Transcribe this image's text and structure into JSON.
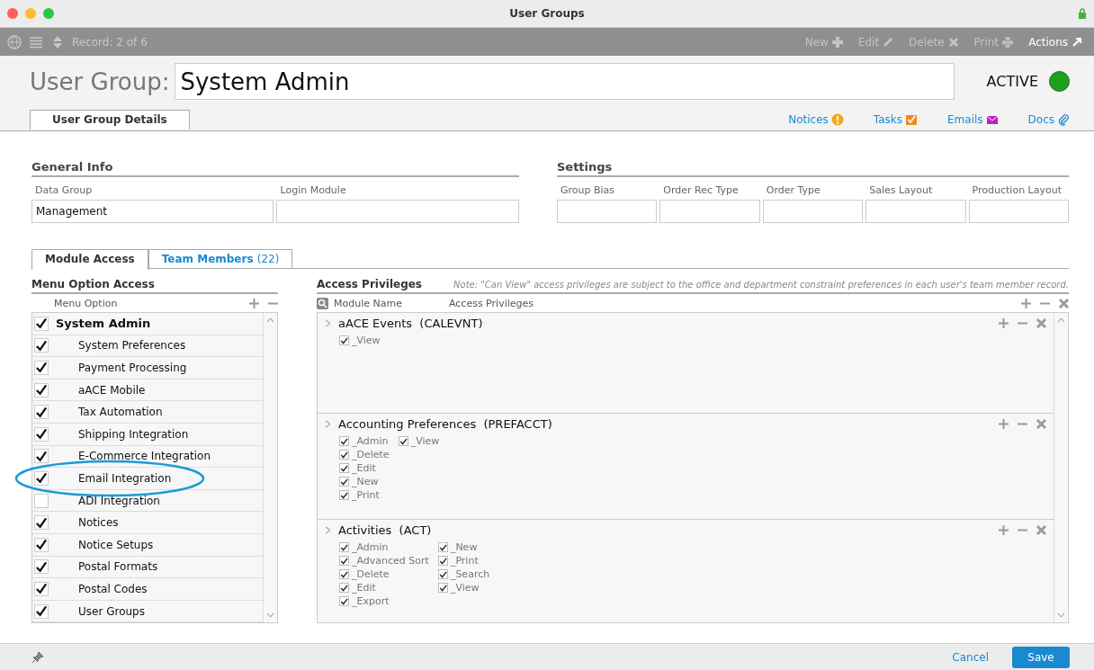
{
  "window": {
    "title": "User Groups"
  },
  "toolbar": {
    "record": "Record: 2 of 6",
    "actions": [
      {
        "label": "New",
        "kind": "plus",
        "disabled": true
      },
      {
        "label": "Edit",
        "kind": "pencil",
        "disabled": true
      },
      {
        "label": "Delete",
        "kind": "cross",
        "disabled": true
      },
      {
        "label": "Print",
        "kind": "printer",
        "disabled": true
      },
      {
        "label": "Actions",
        "kind": "arrow",
        "disabled": false
      }
    ]
  },
  "header": {
    "label": "User Group:",
    "value": "System Admin",
    "status": "ACTIVE",
    "active": true
  },
  "tabs": [
    {
      "label": "User Group Details",
      "selected": true
    }
  ],
  "links": [
    {
      "label": "Notices",
      "kind": "notice"
    },
    {
      "label": "Tasks",
      "kind": "task"
    },
    {
      "label": "Emails",
      "kind": "email"
    },
    {
      "label": "Docs",
      "kind": "clip"
    }
  ],
  "general_info": {
    "title": "General Info",
    "fields": [
      {
        "label": "Data Group",
        "value": "Management"
      },
      {
        "label": "Login Module"
      }
    ]
  },
  "settings": {
    "title": "Settings",
    "fields": [
      {
        "label": "Group Bias"
      },
      {
        "label": "Order Rec Type"
      },
      {
        "label": "Order Type"
      },
      {
        "label": "Sales Layout"
      },
      {
        "label": "Production Layout"
      }
    ]
  },
  "subtabs": [
    {
      "label": "Module Access",
      "selected": true
    },
    {
      "label": "Team Members",
      "count": "(22)",
      "selected": false
    }
  ],
  "menu_access": {
    "title": "Menu Option Access",
    "column": "Menu Option",
    "items": [
      {
        "label": "System Admin",
        "checked": true,
        "kind": "group"
      },
      {
        "label": "System Preferences",
        "checked": true,
        "kind": "item"
      },
      {
        "label": "Payment Processing",
        "checked": true,
        "kind": "item"
      },
      {
        "label": "aACE Mobile",
        "checked": true,
        "kind": "item"
      },
      {
        "label": "Tax Automation",
        "checked": true,
        "kind": "item"
      },
      {
        "label": "Shipping Integration",
        "checked": true,
        "kind": "item"
      },
      {
        "label": "E-Commerce Integration",
        "checked": true,
        "kind": "item"
      },
      {
        "label": "Email Integration",
        "checked": true,
        "kind": "item",
        "highlighted": true
      },
      {
        "label": "ADI Integration",
        "checked": false,
        "kind": "item"
      },
      {
        "label": "Notices",
        "checked": true,
        "kind": "item"
      },
      {
        "label": "Notice Setups",
        "checked": true,
        "kind": "item"
      },
      {
        "label": "Postal Formats",
        "checked": true,
        "kind": "item"
      },
      {
        "label": "Postal Codes",
        "checked": true,
        "kind": "item"
      },
      {
        "label": "User Groups",
        "checked": true,
        "kind": "item"
      }
    ]
  },
  "access_privileges": {
    "title": "Access Privileges",
    "note": "Note: \"Can View\" access privileges are subject to the office and department constraint preferences in each user's team member record.",
    "columns": [
      "Module Name",
      "Access Privileges"
    ],
    "modules": [
      {
        "name": "aACE Events  (CALEVNT)",
        "columns": [
          [
            {
              "label": "_View",
              "checked": true
            }
          ]
        ]
      },
      {
        "name": "Accounting Preferences  (PREFACCT)",
        "columns": [
          [
            {
              "label": "_Admin",
              "checked": true
            },
            {
              "label": "_Delete",
              "checked": true
            },
            {
              "label": "_Edit",
              "checked": true
            },
            {
              "label": "_New",
              "checked": true
            },
            {
              "label": "_Print",
              "checked": true
            }
          ],
          [
            {
              "label": "_View",
              "checked": true
            }
          ]
        ]
      },
      {
        "name": "Activities  (ACT)",
        "columns": [
          [
            {
              "label": "_Admin",
              "checked": true
            },
            {
              "label": "_Advanced Sort",
              "checked": true
            },
            {
              "label": "_Delete",
              "checked": true
            },
            {
              "label": "_Edit",
              "checked": true
            },
            {
              "label": "_Export",
              "checked": true
            }
          ],
          [
            {
              "label": "_New",
              "checked": true
            },
            {
              "label": "_Print",
              "checked": true
            },
            {
              "label": "_Search",
              "checked": true
            },
            {
              "label": "_View",
              "checked": true
            }
          ]
        ]
      }
    ]
  },
  "footer": {
    "buttons": [
      {
        "label": "Cancel",
        "kind": "link"
      },
      {
        "label": "Save",
        "kind": "primary"
      }
    ]
  }
}
